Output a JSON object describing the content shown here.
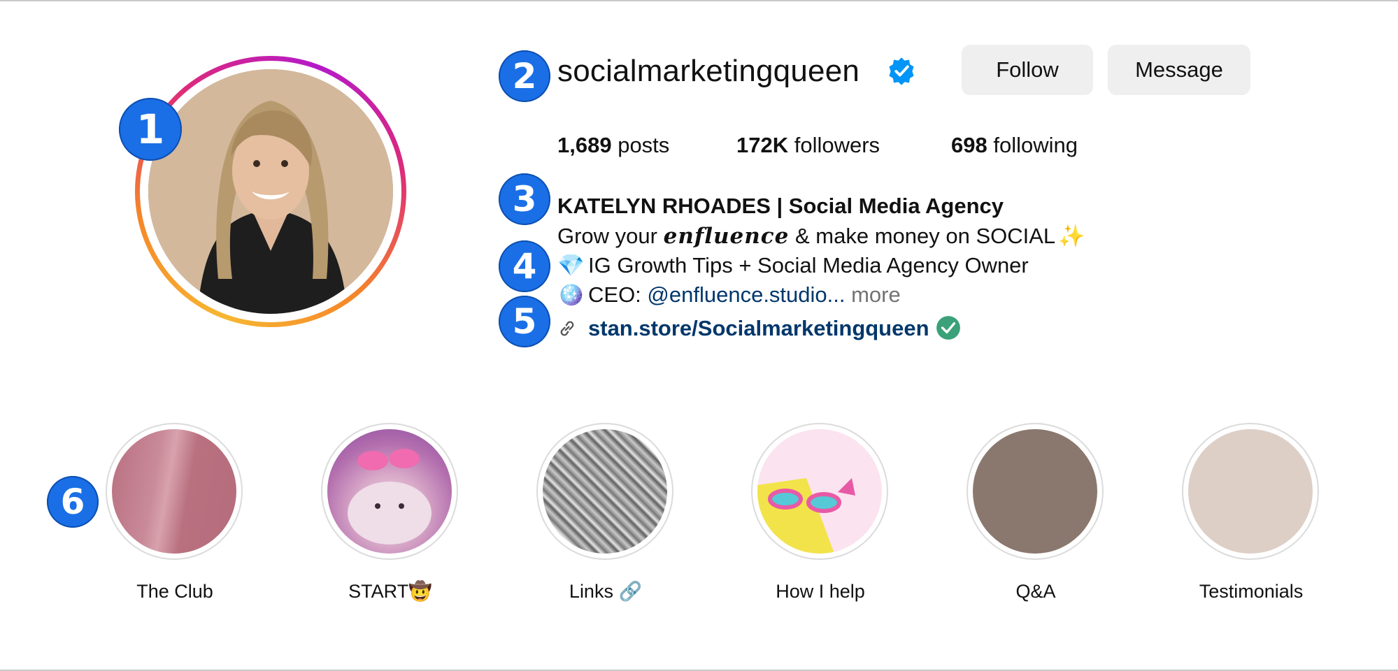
{
  "profile": {
    "username": "socialmarketingqueen",
    "verified_icon": "verified-badge-icon",
    "buttons": {
      "follow": "Follow",
      "message": "Message"
    },
    "stats": {
      "posts_count": "1,689",
      "posts_label": "posts",
      "followers_count": "172K",
      "followers_label": "followers",
      "following_count": "698",
      "following_label": "following"
    },
    "bio": {
      "name": "KATELYN RHOADES | Social Media Agency",
      "line1_a": "Grow your ",
      "line1_fancy": "enfluence",
      "line1_b": " & make money on SOCIAL",
      "line1_emoji": "✨",
      "line2_emoji": "💎",
      "line2": "IG Growth Tips + Social Media Agency Owner",
      "line3_emoji": "🪩",
      "line3_prefix": "CEO: ",
      "line3_mention": "@enfluence.studio...",
      "line3_more": " more"
    },
    "link": {
      "text": "stan.store/Socialmarketingqueen",
      "icon": "link-chain-icon",
      "check_icon": "check-circle-icon"
    }
  },
  "callouts": [
    "1",
    "2",
    "3",
    "4",
    "5",
    "6"
  ],
  "highlights": [
    {
      "label": "The Club"
    },
    {
      "label": "START🤠"
    },
    {
      "label": "Links 🔗"
    },
    {
      "label": "How I help"
    },
    {
      "label": "Q&A"
    },
    {
      "label": "Testimonials"
    }
  ],
  "colors": {
    "accent": "#1a6fe6",
    "link": "#00376b",
    "verified": "#0095f6",
    "check": "#3aa178",
    "button_bg": "#efefef"
  }
}
